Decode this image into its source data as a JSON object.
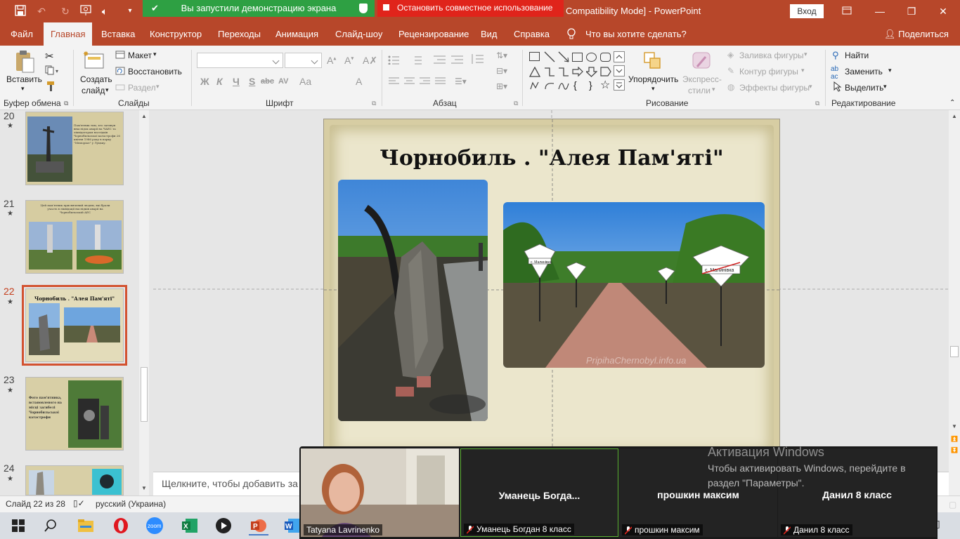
{
  "titlebar": {
    "share_banner": "Вы запустили демонстрацию экрана",
    "stop_share": "Остановить совместное использование",
    "doc_title": "Compatibility Mode]  -  PowerPoint",
    "login": "Вход"
  },
  "tabs": [
    "Файл",
    "Главная",
    "Вставка",
    "Конструктор",
    "Переходы",
    "Анимация",
    "Слайд-шоу",
    "Рецензирование",
    "Вид",
    "Справка",
    "Что вы хотите сделать?"
  ],
  "share_button": "Поделиться",
  "ribbon": {
    "clipboard": {
      "paste": "Вставить",
      "label": "Буфер обмена"
    },
    "slides": {
      "new_slide_line1": "Создать",
      "new_slide_line2": "слайд",
      "layout": "Макет",
      "reset": "Восстановить",
      "section": "Раздел",
      "label": "Слайды"
    },
    "font": {
      "label": "Шрифт",
      "bold": "Ж",
      "italic": "К",
      "underline": "Ч",
      "shadow": "S",
      "strike": "abc",
      "spacing": "AV",
      "case": "Aa",
      "color": "A"
    },
    "paragraph": {
      "label": "Абзац"
    },
    "drawing": {
      "arrange": "Упорядочить",
      "quick_styles_line1": "Экспресс-",
      "quick_styles_line2": "стили",
      "fill": "Заливка фигуры",
      "outline": "Контур фигуры",
      "effects": "Эффекты фигуры",
      "label": "Рисование"
    },
    "editing": {
      "find": "Найти",
      "replace": "Заменить",
      "select": "Выделить",
      "label": "Редактирование"
    }
  },
  "thumbnails": [
    {
      "num": "20",
      "text": "Пам'ятник тим, хто загинув внаслідок аварії на ЧАЕС та ліквідаторам наслідків Чорнобильської катастрофи 26 квітня 1986 року в парку \"Меморіал\" у Луцьку."
    },
    {
      "num": "21",
      "text": "Цей пам'ятник присвячений людям, які брали участь в ліквідації наслідків аварії на Чорнобильській АЕС"
    },
    {
      "num": "22",
      "text": "Чорнобиль . \"Алея Пам'яті\""
    },
    {
      "num": "23",
      "text": "Фото пам'ятника, встановленого на місці загибелі Чорнобильської катастрофи"
    },
    {
      "num": "24",
      "text": ""
    }
  ],
  "slide": {
    "title": "Чорнобиль . \"Алея Пам'яті\"",
    "sign_left": "с. Малинівка",
    "sign_right": "с. Малинівка",
    "photo_watermark": "PripihaChernobyl.info.ua"
  },
  "notes_placeholder": "Щелкните, чтобы добавить за",
  "status": {
    "slide_counter": "Слайд 22 из 28",
    "language": "русский (Украина)"
  },
  "zoom": {
    "participants": [
      {
        "tile_name": "",
        "label": "Tatyana Lavrinenko"
      },
      {
        "tile_name": "Уманець  Богда...",
        "label": "Уманець Богдан 8 класс"
      },
      {
        "tile_name": "прошкин максим",
        "label": "прошкин максим"
      },
      {
        "tile_name": "Данил 8 класс",
        "label": "Данил 8 класс"
      }
    ]
  },
  "activation": {
    "title": "Активация Windows",
    "line": "Чтобы активировать Windows, перейдите в раздел \"Параметры\"."
  },
  "colors": {
    "accent": "#b7472a",
    "share_green": "#2ea043",
    "stop_red": "#e0241b"
  }
}
